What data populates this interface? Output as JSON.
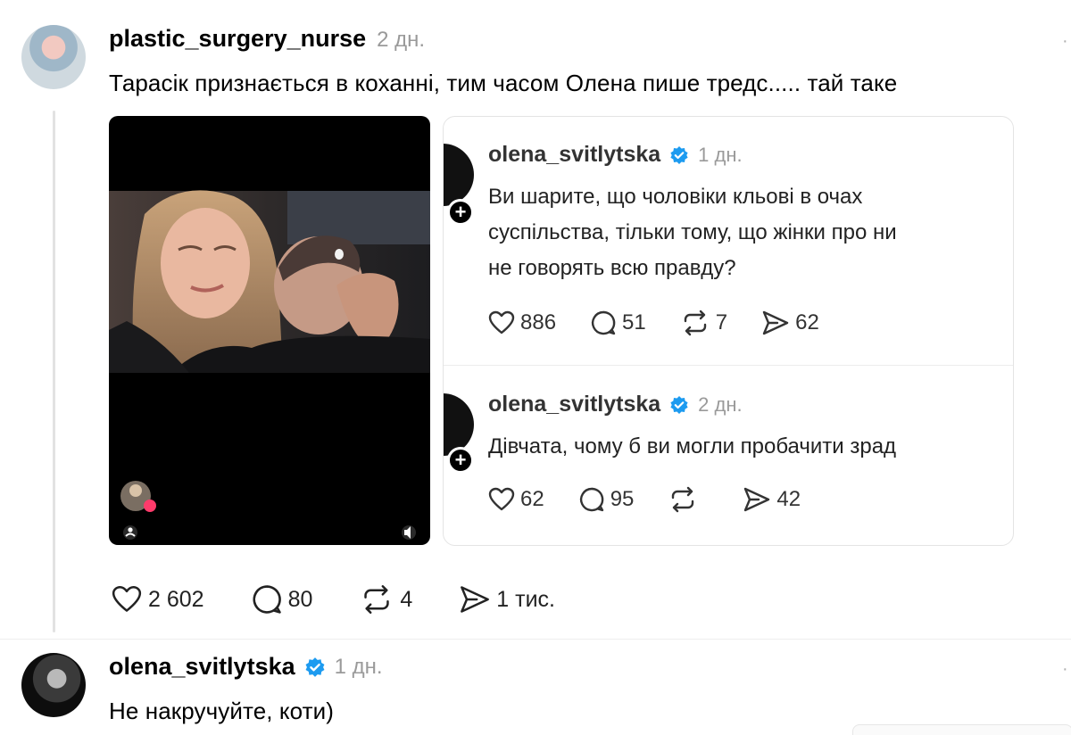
{
  "comment1": {
    "username": "plastic_surgery_nurse",
    "timestamp": "2 дн.",
    "text": "Тарасік признається в коханні, тим часом Олена пише тредс..... тай таке",
    "actions": {
      "likes": "2 602",
      "replies": "80",
      "reposts": "4",
      "shares": "1 тис."
    }
  },
  "embedded": {
    "post1": {
      "username": "olena_svitlytska",
      "timestamp": "1 дн.",
      "lines": [
        "Ви шарите, що чоловіки кльові в очах",
        "суспільства, тільки тому, що жінки про ни",
        "не говорять всю правду?"
      ],
      "actions": {
        "likes": "886",
        "replies": "51",
        "reposts": "7",
        "shares": "62"
      }
    },
    "post2": {
      "username": "olena_svitlytska",
      "timestamp": "2 дн.",
      "text": "Дівчата, чому б ви могли пробачити зрад",
      "actions": {
        "likes": "62",
        "replies": "95",
        "reposts": "",
        "shares": "42"
      }
    }
  },
  "comment2": {
    "username": "olena_svitlytska",
    "timestamp": "1 дн.",
    "text": "Не накручуйте, коти)"
  },
  "icons": {
    "heart": "heart-icon",
    "reply": "reply-icon",
    "repost": "repost-icon",
    "share": "share-icon",
    "verified": "verified-badge-icon",
    "plus": "follow-plus-icon",
    "more": "more-icon"
  },
  "colors": {
    "verified": "#1d9bf0",
    "muted": "#9a9a9a"
  }
}
